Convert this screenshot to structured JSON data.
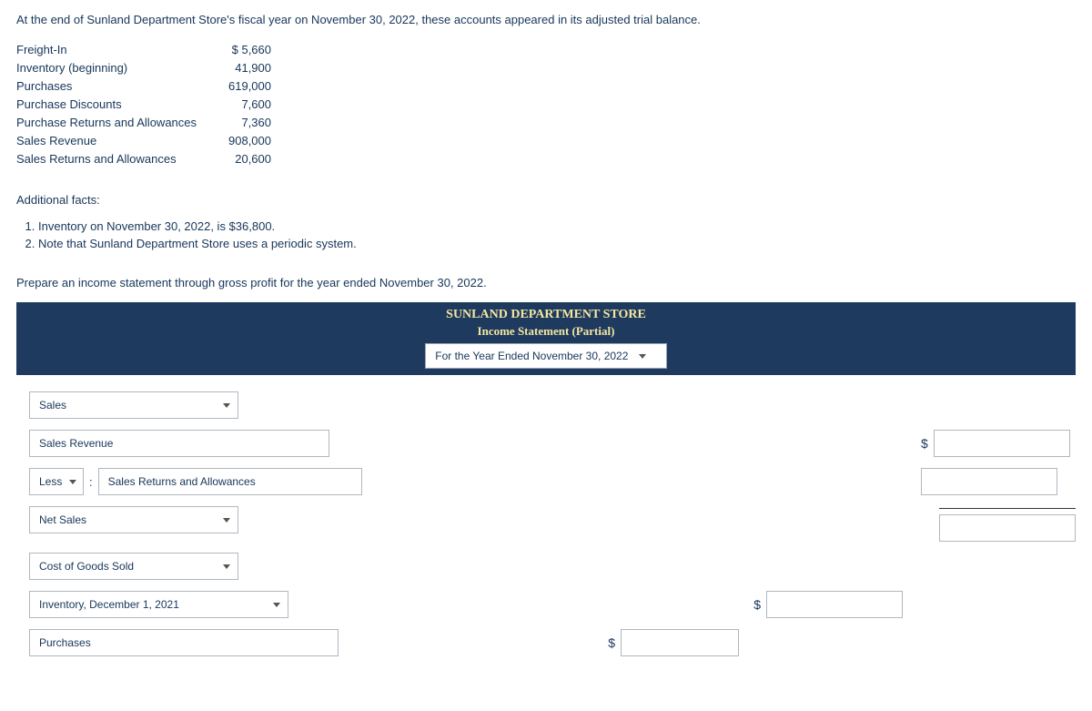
{
  "intro": "At the end of Sunland Department Store's fiscal year on November 30, 2022, these accounts appeared in its adjusted trial balance.",
  "accounts": [
    {
      "label": "Freight-In",
      "value": "$ 5,660"
    },
    {
      "label": "Inventory (beginning)",
      "value": "41,900"
    },
    {
      "label": "Purchases",
      "value": "619,000"
    },
    {
      "label": "Purchase Discounts",
      "value": "7,600"
    },
    {
      "label": "Purchase Returns and Allowances",
      "value": "7,360"
    },
    {
      "label": "Sales Revenue",
      "value": "908,000"
    },
    {
      "label": "Sales Returns and Allowances",
      "value": "20,600"
    }
  ],
  "additional_header": "Additional facts:",
  "facts": [
    "Inventory on November 30, 2022, is $36,800.",
    "Note that Sunland Department Store uses a periodic system."
  ],
  "prepare": "Prepare an income statement through gross profit for the year ended November 30, 2022.",
  "banner": {
    "title": "SUNLAND DEPARTMENT STORE",
    "subtitle": "Income Statement (Partial)",
    "period": "For the Year Ended November 30, 2022"
  },
  "worksheet": {
    "sales_section": "Sales",
    "sales_revenue": "Sales Revenue",
    "less": "Less",
    "colon": ":",
    "sales_returns": "Sales Returns and Allowances",
    "net_sales": "Net Sales",
    "cogs": "Cost of Goods Sold",
    "beg_inv": "Inventory, December 1, 2021",
    "purchases": "Purchases"
  },
  "currency": "$"
}
